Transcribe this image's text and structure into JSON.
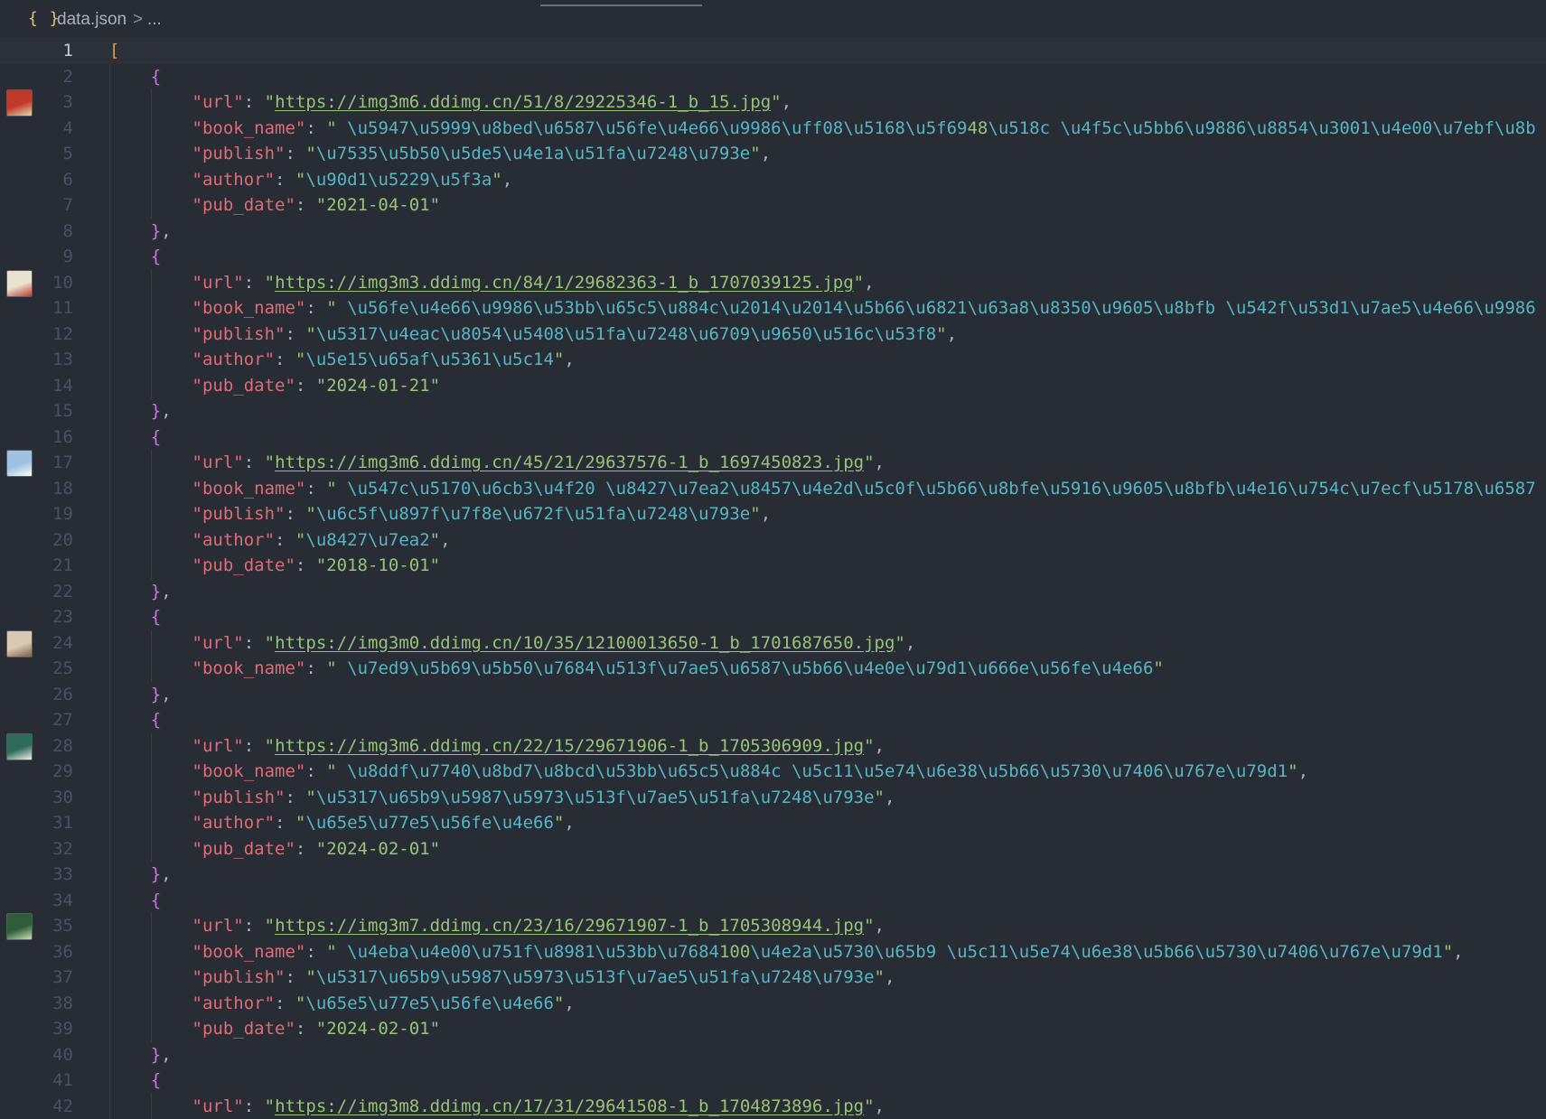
{
  "breadcrumb": {
    "icon": "{ }",
    "file": "data.json",
    "separator": ">",
    "more": "..."
  },
  "current_line": 1,
  "colors": {
    "background": "#282c34",
    "key": "#e06c75",
    "string": "#98c379",
    "escape": "#56b6c2",
    "bracket": "#d19a66",
    "brace": "#c678dd"
  },
  "lines": [
    {
      "n": "1",
      "t": [
        [
          "b1",
          "["
        ]
      ]
    },
    {
      "n": "2",
      "t": [
        [
          "p",
          "    "
        ],
        [
          "b2",
          "{"
        ]
      ]
    },
    {
      "n": "3",
      "thumb": "cover-thumbnail",
      "t": [
        [
          "p",
          "        "
        ],
        [
          "k",
          "\"url\""
        ],
        [
          "p",
          ": "
        ],
        [
          "s",
          "\""
        ],
        [
          "u",
          "https://img3m6.ddimg.cn/51/8/29225346-1_b_15.jpg"
        ],
        [
          "s",
          "\""
        ],
        [
          "p",
          ","
        ]
      ]
    },
    {
      "n": "4",
      "t": [
        [
          "p",
          "        "
        ],
        [
          "k",
          "\"book_name\""
        ],
        [
          "p",
          ": "
        ],
        [
          "s",
          "\" "
        ],
        [
          "e",
          "\\u5947\\u5999\\u8bed\\u6587\\u56fe\\u4e66\\u9986\\uff08\\u5168\\u5f69"
        ],
        [
          "s",
          "48"
        ],
        [
          "e",
          "\\u518c"
        ],
        [
          "s",
          " "
        ],
        [
          "e",
          "\\u4f5c\\u5bb6\\u9886\\u8854\\u3001\\u4e00\\u7ebf\\u8b"
        ]
      ]
    },
    {
      "n": "5",
      "t": [
        [
          "p",
          "        "
        ],
        [
          "k",
          "\"publish\""
        ],
        [
          "p",
          ": "
        ],
        [
          "s",
          "\""
        ],
        [
          "e",
          "\\u7535\\u5b50\\u5de5\\u4e1a\\u51fa\\u7248\\u793e"
        ],
        [
          "s",
          "\""
        ],
        [
          "p",
          ","
        ]
      ]
    },
    {
      "n": "6",
      "t": [
        [
          "p",
          "        "
        ],
        [
          "k",
          "\"author\""
        ],
        [
          "p",
          ": "
        ],
        [
          "s",
          "\""
        ],
        [
          "e",
          "\\u90d1\\u5229\\u5f3a"
        ],
        [
          "s",
          "\""
        ],
        [
          "p",
          ","
        ]
      ]
    },
    {
      "n": "7",
      "t": [
        [
          "p",
          "        "
        ],
        [
          "k",
          "\"pub_date\""
        ],
        [
          "p",
          ": "
        ],
        [
          "s",
          "\"2021-04-01\""
        ]
      ]
    },
    {
      "n": "8",
      "t": [
        [
          "p",
          "    "
        ],
        [
          "b2",
          "}"
        ],
        [
          "p",
          ","
        ]
      ]
    },
    {
      "n": "9",
      "t": [
        [
          "p",
          "    "
        ],
        [
          "b2",
          "{"
        ]
      ]
    },
    {
      "n": "10",
      "thumb": "cover-thumbnail",
      "t": [
        [
          "p",
          "        "
        ],
        [
          "k",
          "\"url\""
        ],
        [
          "p",
          ": "
        ],
        [
          "s",
          "\""
        ],
        [
          "u",
          "https://img3m3.ddimg.cn/84/1/29682363-1_b_1707039125.jpg"
        ],
        [
          "s",
          "\""
        ],
        [
          "p",
          ","
        ]
      ]
    },
    {
      "n": "11",
      "t": [
        [
          "p",
          "        "
        ],
        [
          "k",
          "\"book_name\""
        ],
        [
          "p",
          ": "
        ],
        [
          "s",
          "\" "
        ],
        [
          "e",
          "\\u56fe\\u4e66\\u9986\\u53bb\\u65c5\\u884c\\u2014\\u2014\\u5b66\\u6821\\u63a8\\u8350\\u9605\\u8bfb"
        ],
        [
          "s",
          " "
        ],
        [
          "e",
          "\\u542f\\u53d1\\u7ae5\\u4e66\\u9986"
        ]
      ]
    },
    {
      "n": "12",
      "t": [
        [
          "p",
          "        "
        ],
        [
          "k",
          "\"publish\""
        ],
        [
          "p",
          ": "
        ],
        [
          "s",
          "\""
        ],
        [
          "e",
          "\\u5317\\u4eac\\u8054\\u5408\\u51fa\\u7248\\u6709\\u9650\\u516c\\u53f8"
        ],
        [
          "s",
          "\""
        ],
        [
          "p",
          ","
        ]
      ]
    },
    {
      "n": "13",
      "t": [
        [
          "p",
          "        "
        ],
        [
          "k",
          "\"author\""
        ],
        [
          "p",
          ": "
        ],
        [
          "s",
          "\""
        ],
        [
          "e",
          "\\u5e15\\u65af\\u5361\\u5c14"
        ],
        [
          "s",
          "\""
        ],
        [
          "p",
          ","
        ]
      ]
    },
    {
      "n": "14",
      "t": [
        [
          "p",
          "        "
        ],
        [
          "k",
          "\"pub_date\""
        ],
        [
          "p",
          ": "
        ],
        [
          "s",
          "\"2024-01-21\""
        ]
      ]
    },
    {
      "n": "15",
      "t": [
        [
          "p",
          "    "
        ],
        [
          "b2",
          "}"
        ],
        [
          "p",
          ","
        ]
      ]
    },
    {
      "n": "16",
      "t": [
        [
          "p",
          "    "
        ],
        [
          "b2",
          "{"
        ]
      ]
    },
    {
      "n": "17",
      "thumb": "cover-thumbnail",
      "t": [
        [
          "p",
          "        "
        ],
        [
          "k",
          "\"url\""
        ],
        [
          "p",
          ": "
        ],
        [
          "s",
          "\""
        ],
        [
          "u",
          "https://img3m6.ddimg.cn/45/21/29637576-1_b_1697450823.jpg"
        ],
        [
          "s",
          "\""
        ],
        [
          "p",
          ","
        ]
      ]
    },
    {
      "n": "18",
      "t": [
        [
          "p",
          "        "
        ],
        [
          "k",
          "\"book_name\""
        ],
        [
          "p",
          ": "
        ],
        [
          "s",
          "\" "
        ],
        [
          "e",
          "\\u547c\\u5170\\u6cb3\\u4f20"
        ],
        [
          "s",
          " "
        ],
        [
          "e",
          "\\u8427\\u7ea2\\u8457\\u4e2d\\u5c0f\\u5b66\\u8bfe\\u5916\\u9605\\u8bfb\\u4e16\\u754c\\u7ecf\\u5178\\u6587"
        ]
      ]
    },
    {
      "n": "19",
      "t": [
        [
          "p",
          "        "
        ],
        [
          "k",
          "\"publish\""
        ],
        [
          "p",
          ": "
        ],
        [
          "s",
          "\""
        ],
        [
          "e",
          "\\u6c5f\\u897f\\u7f8e\\u672f\\u51fa\\u7248\\u793e"
        ],
        [
          "s",
          "\""
        ],
        [
          "p",
          ","
        ]
      ]
    },
    {
      "n": "20",
      "t": [
        [
          "p",
          "        "
        ],
        [
          "k",
          "\"author\""
        ],
        [
          "p",
          ": "
        ],
        [
          "s",
          "\""
        ],
        [
          "e",
          "\\u8427\\u7ea2"
        ],
        [
          "s",
          "\""
        ],
        [
          "p",
          ","
        ]
      ]
    },
    {
      "n": "21",
      "t": [
        [
          "p",
          "        "
        ],
        [
          "k",
          "\"pub_date\""
        ],
        [
          "p",
          ": "
        ],
        [
          "s",
          "\"2018-10-01\""
        ]
      ]
    },
    {
      "n": "22",
      "t": [
        [
          "p",
          "    "
        ],
        [
          "b2",
          "}"
        ],
        [
          "p",
          ","
        ]
      ]
    },
    {
      "n": "23",
      "t": [
        [
          "p",
          "    "
        ],
        [
          "b2",
          "{"
        ]
      ]
    },
    {
      "n": "24",
      "thumb": "cover-thumbnail",
      "t": [
        [
          "p",
          "        "
        ],
        [
          "k",
          "\"url\""
        ],
        [
          "p",
          ": "
        ],
        [
          "s",
          "\""
        ],
        [
          "u",
          "https://img3m0.ddimg.cn/10/35/12100013650-1_b_1701687650.jpg"
        ],
        [
          "s",
          "\""
        ],
        [
          "p",
          ","
        ]
      ]
    },
    {
      "n": "25",
      "t": [
        [
          "p",
          "        "
        ],
        [
          "k",
          "\"book_name\""
        ],
        [
          "p",
          ": "
        ],
        [
          "s",
          "\" "
        ],
        [
          "e",
          "\\u7ed9\\u5b69\\u5b50\\u7684\\u513f\\u7ae5\\u6587\\u5b66\\u4e0e\\u79d1\\u666e\\u56fe\\u4e66"
        ],
        [
          "s",
          "\""
        ]
      ]
    },
    {
      "n": "26",
      "t": [
        [
          "p",
          "    "
        ],
        [
          "b2",
          "}"
        ],
        [
          "p",
          ","
        ]
      ]
    },
    {
      "n": "27",
      "t": [
        [
          "p",
          "    "
        ],
        [
          "b2",
          "{"
        ]
      ]
    },
    {
      "n": "28",
      "thumb": "cover-thumbnail",
      "t": [
        [
          "p",
          "        "
        ],
        [
          "k",
          "\"url\""
        ],
        [
          "p",
          ": "
        ],
        [
          "s",
          "\""
        ],
        [
          "u",
          "https://img3m6.ddimg.cn/22/15/29671906-1_b_1705306909.jpg"
        ],
        [
          "s",
          "\""
        ],
        [
          "p",
          ","
        ]
      ]
    },
    {
      "n": "29",
      "t": [
        [
          "p",
          "        "
        ],
        [
          "k",
          "\"book_name\""
        ],
        [
          "p",
          ": "
        ],
        [
          "s",
          "\" "
        ],
        [
          "e",
          "\\u8ddf\\u7740\\u8bd7\\u8bcd\\u53bb\\u65c5\\u884c"
        ],
        [
          "s",
          " "
        ],
        [
          "e",
          "\\u5c11\\u5e74\\u6e38\\u5b66\\u5730\\u7406\\u767e\\u79d1"
        ],
        [
          "s",
          "\""
        ],
        [
          "p",
          ","
        ]
      ]
    },
    {
      "n": "30",
      "t": [
        [
          "p",
          "        "
        ],
        [
          "k",
          "\"publish\""
        ],
        [
          "p",
          ": "
        ],
        [
          "s",
          "\""
        ],
        [
          "e",
          "\\u5317\\u65b9\\u5987\\u5973\\u513f\\u7ae5\\u51fa\\u7248\\u793e"
        ],
        [
          "s",
          "\""
        ],
        [
          "p",
          ","
        ]
      ]
    },
    {
      "n": "31",
      "t": [
        [
          "p",
          "        "
        ],
        [
          "k",
          "\"author\""
        ],
        [
          "p",
          ": "
        ],
        [
          "s",
          "\""
        ],
        [
          "e",
          "\\u65e5\\u77e5\\u56fe\\u4e66"
        ],
        [
          "s",
          "\""
        ],
        [
          "p",
          ","
        ]
      ]
    },
    {
      "n": "32",
      "t": [
        [
          "p",
          "        "
        ],
        [
          "k",
          "\"pub_date\""
        ],
        [
          "p",
          ": "
        ],
        [
          "s",
          "\"2024-02-01\""
        ]
      ]
    },
    {
      "n": "33",
      "t": [
        [
          "p",
          "    "
        ],
        [
          "b2",
          "}"
        ],
        [
          "p",
          ","
        ]
      ]
    },
    {
      "n": "34",
      "t": [
        [
          "p",
          "    "
        ],
        [
          "b2",
          "{"
        ]
      ]
    },
    {
      "n": "35",
      "thumb": "cover-thumbnail",
      "t": [
        [
          "p",
          "        "
        ],
        [
          "k",
          "\"url\""
        ],
        [
          "p",
          ": "
        ],
        [
          "s",
          "\""
        ],
        [
          "u",
          "https://img3m7.ddimg.cn/23/16/29671907-1_b_1705308944.jpg"
        ],
        [
          "s",
          "\""
        ],
        [
          "p",
          ","
        ]
      ]
    },
    {
      "n": "36",
      "t": [
        [
          "p",
          "        "
        ],
        [
          "k",
          "\"book_name\""
        ],
        [
          "p",
          ": "
        ],
        [
          "s",
          "\" "
        ],
        [
          "e",
          "\\u4eba\\u4e00\\u751f\\u8981\\u53bb\\u7684"
        ],
        [
          "s",
          "100"
        ],
        [
          "e",
          "\\u4e2a\\u5730\\u65b9"
        ],
        [
          "s",
          " "
        ],
        [
          "e",
          "\\u5c11\\u5e74\\u6e38\\u5b66\\u5730\\u7406\\u767e\\u79d1"
        ],
        [
          "s",
          "\""
        ],
        [
          "p",
          ","
        ]
      ]
    },
    {
      "n": "37",
      "t": [
        [
          "p",
          "        "
        ],
        [
          "k",
          "\"publish\""
        ],
        [
          "p",
          ": "
        ],
        [
          "s",
          "\""
        ],
        [
          "e",
          "\\u5317\\u65b9\\u5987\\u5973\\u513f\\u7ae5\\u51fa\\u7248\\u793e"
        ],
        [
          "s",
          "\""
        ],
        [
          "p",
          ","
        ]
      ]
    },
    {
      "n": "38",
      "t": [
        [
          "p",
          "        "
        ],
        [
          "k",
          "\"author\""
        ],
        [
          "p",
          ": "
        ],
        [
          "s",
          "\""
        ],
        [
          "e",
          "\\u65e5\\u77e5\\u56fe\\u4e66"
        ],
        [
          "s",
          "\""
        ],
        [
          "p",
          ","
        ]
      ]
    },
    {
      "n": "39",
      "t": [
        [
          "p",
          "        "
        ],
        [
          "k",
          "\"pub_date\""
        ],
        [
          "p",
          ": "
        ],
        [
          "s",
          "\"2024-02-01\""
        ]
      ]
    },
    {
      "n": "40",
      "t": [
        [
          "p",
          "    "
        ],
        [
          "b2",
          "}"
        ],
        [
          "p",
          ","
        ]
      ]
    },
    {
      "n": "41",
      "t": [
        [
          "p",
          "    "
        ],
        [
          "b2",
          "{"
        ]
      ]
    },
    {
      "n": "42",
      "t": [
        [
          "p",
          "        "
        ],
        [
          "k",
          "\"url\""
        ],
        [
          "p",
          ": "
        ],
        [
          "s",
          "\""
        ],
        [
          "u",
          "https://img3m8.ddimg.cn/17/31/29641508-1_b_1704873896.jpg"
        ],
        [
          "s",
          "\""
        ],
        [
          "p",
          ","
        ]
      ]
    }
  ]
}
